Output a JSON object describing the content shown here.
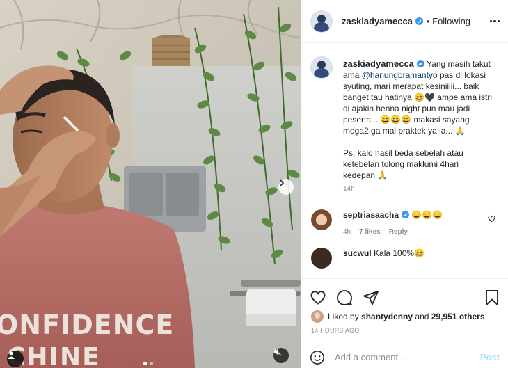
{
  "post": {
    "author": "zaskiadyamecca",
    "follow_state": "Following",
    "caption_author": "zaskiadyamecca",
    "caption_pre": "Yang masih takut ama ",
    "caption_mention": "@hanungbramantyo",
    "caption_post": " pas di lokasi syuting, mari merapat kesiniiiii... baik banget tau hatinya 😄🖤 ampe ama istri di ajakin henna night pun mau jadi peserta... 😄😄😄 makasi sayang moga2 ga mal praktek ya ia... 🙏\n\nPs: kalo hasil beda sebelah atau ketebelan tolong maklumi 4hari kedepan 🙏",
    "caption_time": "14h"
  },
  "comments": [
    {
      "user": "septriasaacha",
      "text": "😄😄😄",
      "time": "4h",
      "likes": "7 likes",
      "reply": "Reply"
    },
    {
      "user": "sucwul",
      "text": "Kala 100%😄"
    }
  ],
  "likes": {
    "prefix": "Liked by",
    "user": "shantydenny",
    "mid": "and",
    "count": "29,951 others"
  },
  "timestamp": "14 HOURS AGO",
  "add_comment": {
    "placeholder": "Add a comment...",
    "post_label": "Post"
  },
  "media": {
    "shirt_text_1": "ONFIDENCE",
    "shirt_text_2": "CHINE",
    "carousel_index": 0,
    "carousel_count": 2
  },
  "colors": {
    "verified": "#3897f0",
    "mention": "#00376b",
    "post_disabled": "#b2dffc"
  },
  "icons": [
    "verified-badge-icon",
    "more-options-icon",
    "heart-icon",
    "comment-icon",
    "share-icon",
    "save-icon",
    "emoji-icon",
    "next-arrow-icon",
    "mute-icon",
    "user-tag-icon"
  ]
}
